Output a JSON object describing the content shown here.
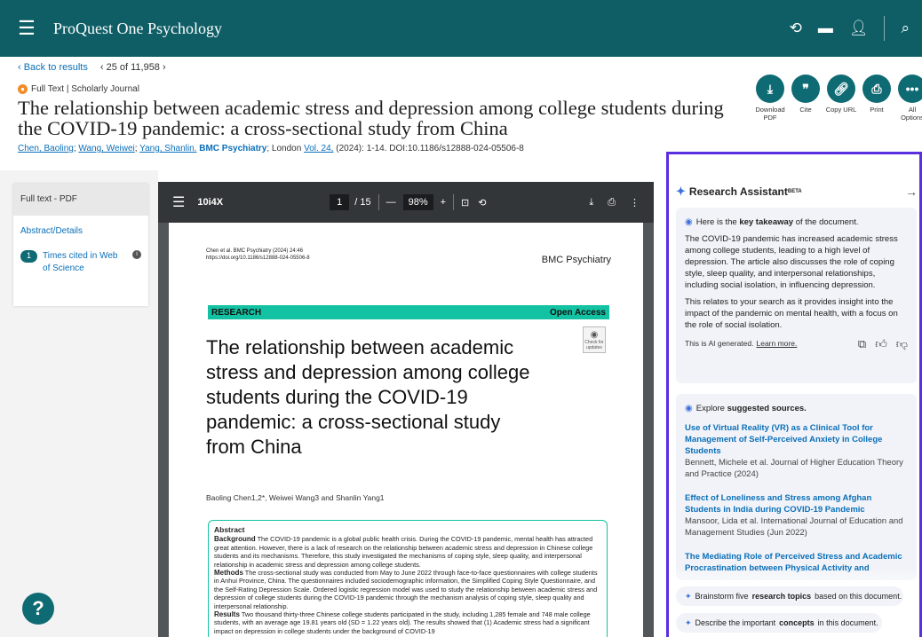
{
  "header": {
    "brand": "ProQuest One Psychology",
    "icons": [
      "history-icon",
      "folder-icon",
      "user-icon",
      "search-icon"
    ]
  },
  "nav": {
    "back": "‹ Back to results",
    "position": "‹ 25 of 11,958 ›"
  },
  "record": {
    "doc_type": "Full Text | Scholarly Journal",
    "title": "The relationship between academic stress and depression among college students during the COVID-19 pandemic: a cross-sectional study from China",
    "authors": [
      "Chen, Baoling",
      "Wang, Weiwei",
      "Yang, Shanlin."
    ],
    "journal": "BMC Psychiatry",
    "place": "; London",
    "volume": "Vol. 24,",
    "citation_rest": "(2024): 1-14. DOI:10.1186/s12888-024-05506-8"
  },
  "actions": [
    {
      "label": "Download PDF",
      "icon": "download-pdf-icon"
    },
    {
      "label": "Cite",
      "icon": "quote-icon"
    },
    {
      "label": "Copy URL",
      "icon": "link-icon"
    },
    {
      "label": "Print",
      "icon": "print-icon"
    },
    {
      "label": "All Options",
      "icon": "more-icon"
    }
  ],
  "left_panel": {
    "full_text_pdf": "Full text - PDF",
    "abstract_details": "Abstract/Details",
    "times_cited_count": "1",
    "times_cited_label": "Times cited in Web of Science"
  },
  "pdf_viewer": {
    "file_name": "10i4X",
    "page_current": "1",
    "page_total": "/ 15",
    "zoom": "98%",
    "page": {
      "header_line1": "Chen et al. BMC Psychiatry (2024) 24:46",
      "header_line2": "https://doi.org/10.1186/s12888-024-05506-8",
      "journal": "BMC Psychiatry",
      "band_left": "RESEARCH",
      "band_right": "Open Access",
      "check_updates": "Check for updates",
      "title": "The relationship between academic stress and depression among college students during the COVID-19 pandemic: a cross-sectional study from China",
      "authors": "Baoling Chen1,2*, Weiwei Wang3 and Shanlin Yang1",
      "abstract_heading": "Abstract",
      "background_label": "Background",
      "background_text": "The COVID-19 pandemic is a global public health crisis. During the COVID-19 pandemic, mental health has attracted great attention. However, there is a lack of research on the relationship between academic stress and depression in Chinese college students and its mechanisms. Therefore, this study investigated the mechanisms of coping style, sleep quality, and interpersonal relationship in academic stress and depression among college students.",
      "methods_label": "Methods",
      "methods_text": "The cross-sectional study was conducted from May to June 2022 through face-to-face questionnaires with college students in Anhui Province, China. The questionnaires included sociodemographic information, the Simplified Coping Style Questionnaire, and the Self-Rating Depression Scale. Ordered logistic regression model was used to study the relationship between academic stress and depression of college students during the COVID-19 pandemic through the mechanism analysis of coping style, sleep quality and interpersonal relationship.",
      "results_label": "Results",
      "results_text": "Two thousand thirty-three Chinese college students participated in the study, including 1,285 female and 748 male college students, with an average age 19.81 years old (SD = 1.22 years old). The results showed that (1) Academic stress had a significant impact on depression in college students under the background of COVID-19"
    }
  },
  "research_assistant": {
    "title": "Research Assistant",
    "beta": "BETA",
    "takeaway_pre": "Here is the ",
    "takeaway_bold": "key takeaway",
    "takeaway_post": " of the document.",
    "summary_p1": "The COVID-19 pandemic has increased academic stress among college students, leading to a high level of depression. The article also discusses the role of coping style, sleep quality, and interpersonal relationships, including social isolation, in influencing depression.",
    "summary_p2": "This relates to your search as it provides insight into the impact of the pandemic on mental health, with a focus on the role of social isolation.",
    "ai_note": "This is AI generated.",
    "learn_more": "Learn more.",
    "explore_pre": "Explore ",
    "explore_bold": "suggested sources.",
    "sources": [
      {
        "title": "Use of Virtual Reality (VR) as a Clinical Tool for Management of Self-Perceived Anxiety in College Students",
        "meta": "Bennett, Michele et al. Journal of Higher Education Theory and Practice (2024)"
      },
      {
        "title": "Effect of Loneliness and Stress among Afghan Students in India during COVID-19 Pandemic",
        "meta": "Mansoor, Lida et al. International Journal of Education and Management Studies (Jun 2022)"
      },
      {
        "title": "The Mediating Role of Perceived Stress and Academic Procrastination between Physical Activity and",
        "meta": ""
      }
    ],
    "prompt1_pre": "Brainstorm five ",
    "prompt1_bold": "research topics",
    "prompt1_post": " based on this document.",
    "prompt2_pre": "Describe the important ",
    "prompt2_bold": "concepts",
    "prompt2_post": " in this document."
  },
  "colors": {
    "header": "#0f5e66",
    "accent": "#0f6b73",
    "link": "#0b6fb8",
    "assistant_border": "#5b2ee0",
    "research_band": "#13c2a2"
  }
}
